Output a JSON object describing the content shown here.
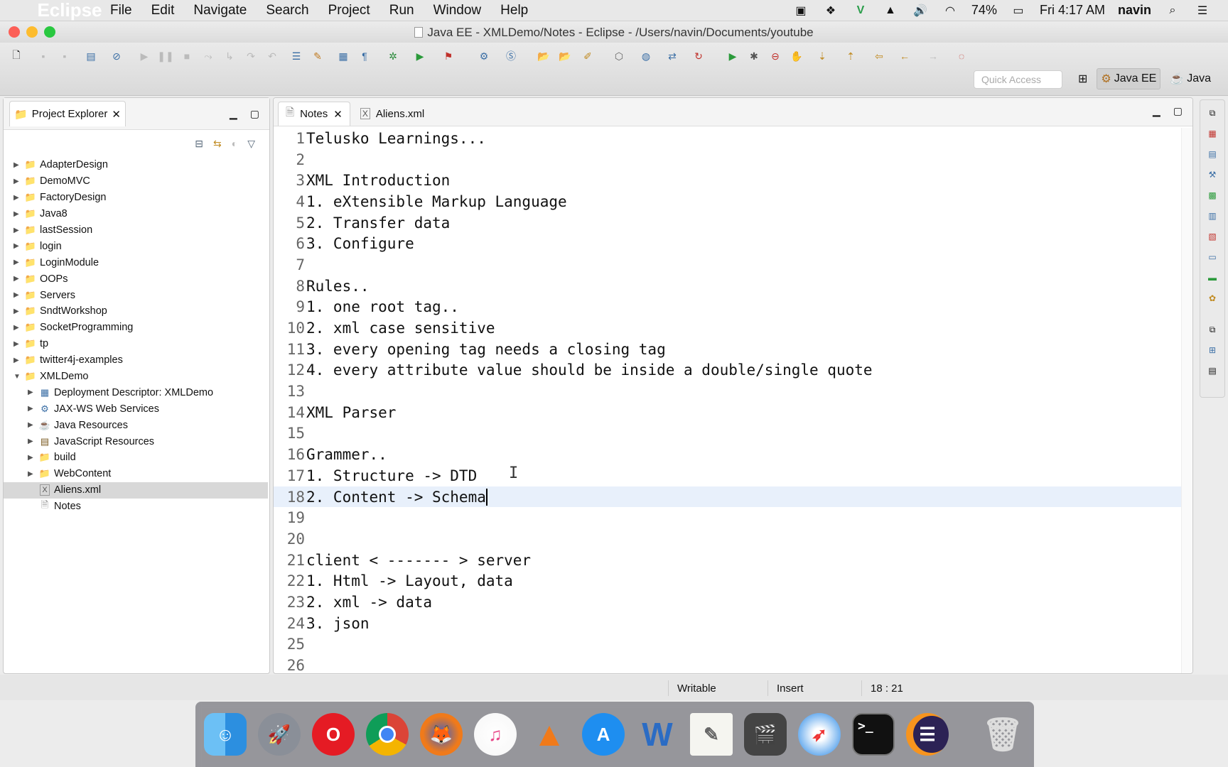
{
  "menubar": {
    "app_name": "Eclipse",
    "items": [
      "File",
      "Edit",
      "Navigate",
      "Search",
      "Project",
      "Run",
      "Window",
      "Help"
    ],
    "battery": "74%",
    "clock": "Fri 4:17 AM",
    "user": "navin"
  },
  "window": {
    "title": "Java EE - XMLDemo/Notes - Eclipse - /Users/navin/Documents/youtube"
  },
  "toolbar": {
    "quick_access_placeholder": "Quick Access",
    "perspectives": [
      "Java EE",
      "Java"
    ]
  },
  "project_explorer": {
    "title": "Project Explorer",
    "items": [
      {
        "label": "AdapterDesign",
        "expanded": false,
        "icon": "project-icon"
      },
      {
        "label": "DemoMVC",
        "expanded": false,
        "icon": "project-error-icon"
      },
      {
        "label": "FactoryDesign",
        "expanded": false,
        "icon": "project-icon"
      },
      {
        "label": "Java8",
        "expanded": false,
        "icon": "project-icon"
      },
      {
        "label": "lastSession",
        "expanded": false,
        "icon": "project-icon"
      },
      {
        "label": "login",
        "expanded": false,
        "icon": "folder-icon"
      },
      {
        "label": "LoginModule",
        "expanded": false,
        "icon": "project-error-icon"
      },
      {
        "label": "OOPs",
        "expanded": false,
        "icon": "project-icon"
      },
      {
        "label": "Servers",
        "expanded": false,
        "icon": "folder-icon"
      },
      {
        "label": "SndtWorkshop",
        "expanded": false,
        "icon": "project-error-icon"
      },
      {
        "label": "SocketProgramming",
        "expanded": false,
        "icon": "project-icon"
      },
      {
        "label": "tp",
        "expanded": false,
        "icon": "project-error-icon"
      },
      {
        "label": "twitter4j-examples",
        "expanded": false,
        "icon": "project-icon"
      },
      {
        "label": "XMLDemo",
        "expanded": true,
        "icon": "project-icon"
      }
    ],
    "children": [
      {
        "label": "Deployment Descriptor: XMLDemo",
        "icon": "descriptor-icon",
        "arrow": true
      },
      {
        "label": "JAX-WS Web Services",
        "icon": "webservice-icon",
        "arrow": true
      },
      {
        "label": "Java Resources",
        "icon": "java-resources-icon",
        "arrow": true
      },
      {
        "label": "JavaScript Resources",
        "icon": "js-resources-icon",
        "arrow": true
      },
      {
        "label": "build",
        "icon": "folder-icon",
        "arrow": true
      },
      {
        "label": "WebContent",
        "icon": "folder-icon",
        "arrow": true
      },
      {
        "label": "Aliens.xml",
        "icon": "xml-file-icon",
        "arrow": false,
        "selected": true
      },
      {
        "label": "Notes",
        "icon": "text-file-icon",
        "arrow": false
      }
    ]
  },
  "editor": {
    "tabs": [
      {
        "label": "Notes",
        "active": true
      },
      {
        "label": "Aliens.xml",
        "active": false
      }
    ],
    "current_line": 18,
    "lines": [
      "Telusko Learnings...",
      "",
      "XML Introduction",
      "1. eXtensible Markup Language",
      "2. Transfer data",
      "3. Configure",
      "",
      "Rules..",
      "1. one root tag..",
      "2. xml case sensitive",
      "3. every opening tag needs a closing tag",
      "4. every attribute value should be inside a double/single quote",
      "",
      "XML Parser",
      "",
      "Grammer..",
      "1. Structure -> DTD",
      "2. Content -> Schema",
      "",
      "",
      "client < ------- > server",
      "1. Html -> Layout, data",
      "2. xml -> data",
      "3. json",
      "",
      ""
    ]
  },
  "statusbar": {
    "mode": "Writable",
    "insert": "Insert",
    "position": "18 : 21"
  },
  "dock": {
    "apps": [
      "Finder",
      "Launchpad",
      "Opera",
      "Chrome",
      "Firefox",
      "iTunes",
      "VLC",
      "App Store",
      "Word",
      "TextEdit",
      "Photo Booth",
      "Safari",
      "Terminal",
      "Eclipse",
      "Trash"
    ]
  }
}
